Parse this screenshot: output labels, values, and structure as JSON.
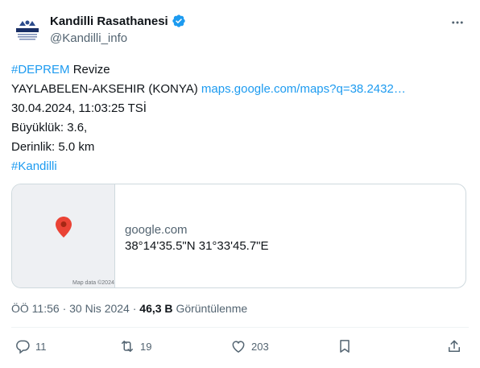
{
  "tweet": {
    "author": {
      "display_name": "Kandilli Rasathanesi",
      "handle": "@Kandilli_info",
      "verified": true,
      "avatar_text": "KANDİLLİ"
    },
    "text": {
      "hashtag1": "#DEPREM",
      "line1_rest": " Revize",
      "location": "YAYLABELEN-AKSEHIR (KONYA) ",
      "maps_link": "maps.google.com/maps?q=38.2432…",
      "datetime": "30.04.2024, 11:03:25 TSİ",
      "magnitude": "Büyüklük: 3.6,",
      "depth": "Derinlik: 5.0 km",
      "hashtag2": "#Kandilli"
    },
    "card": {
      "domain": "google.com",
      "title": "38°14'35.5\"N 31°33'45.7\"E",
      "map_credit": "Map data ©2024"
    },
    "meta": {
      "time": "ÖÖ 11:56",
      "separator": "·",
      "date": "30 Nis 2024",
      "views_count": "46,3 B",
      "views_label": "Görüntülenme"
    },
    "actions": {
      "replies": "11",
      "reposts": "19",
      "likes": "203"
    },
    "colors": {
      "link": "#1d9bf0",
      "verified": "#1d9bf0",
      "pin": "#ea4335",
      "muted": "#536471"
    }
  }
}
